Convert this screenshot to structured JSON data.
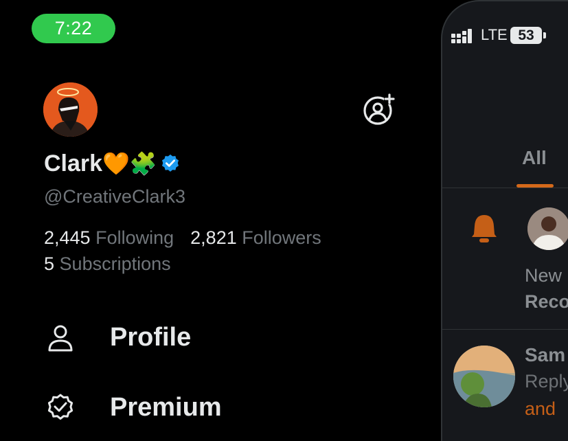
{
  "status_bar": {
    "time": "7:22",
    "carrier": "LTE",
    "battery": "53"
  },
  "profile": {
    "name": "Clark",
    "name_emojis": "🧡🧩",
    "handle": "@CreativeClark3",
    "following_count": "2,445",
    "following_label": "Following",
    "followers_count": "2,821",
    "followers_label": "Followers",
    "subscriptions_count": "5",
    "subscriptions_label": "Subscriptions"
  },
  "menu": {
    "items": [
      {
        "label": "Profile",
        "icon": "person-icon"
      },
      {
        "label": "Premium",
        "icon": "verified-badge-icon"
      }
    ]
  },
  "notifications_panel": {
    "tab_all": "All",
    "notification_line1": "New",
    "notification_line2": "Reco",
    "reply_name": "Sam",
    "reply_sub": "Reply",
    "reply_orange": "and"
  },
  "colors": {
    "status_pill": "#31c94e",
    "verified_blue": "#1d9bf0",
    "accent_orange": "#d4691a",
    "muted_text": "#71767b"
  }
}
